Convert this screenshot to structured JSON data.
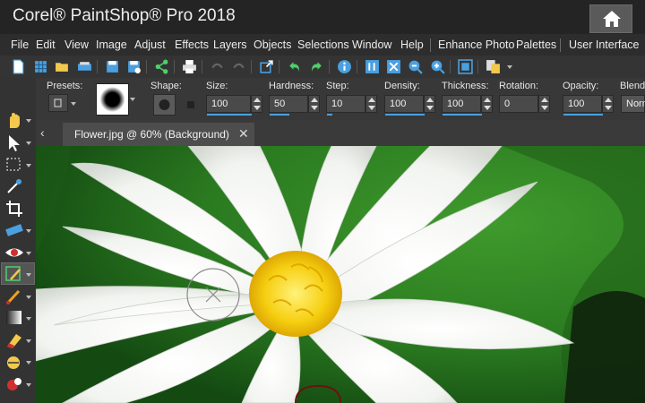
{
  "app": {
    "title": "Corel® PaintShop® Pro 2018"
  },
  "menu": [
    "File",
    "Edit",
    "View",
    "Image",
    "Adjust",
    "Effects",
    "Layers",
    "Objects",
    "Selections",
    "Window",
    "Help",
    "Enhance Photo",
    "Palettes",
    "User Interface"
  ],
  "options": {
    "presets_label": "Presets:",
    "shape_label": "Shape:",
    "size": {
      "label": "Size:",
      "value": "100"
    },
    "hardness": {
      "label": "Hardness:",
      "value": "50"
    },
    "step": {
      "label": "Step:",
      "value": "10"
    },
    "density": {
      "label": "Density:",
      "value": "100"
    },
    "thickness": {
      "label": "Thickness:",
      "value": "100"
    },
    "rotation": {
      "label": "Rotation:",
      "value": "0"
    },
    "opacity": {
      "label": "Opacity:",
      "value": "100"
    },
    "blend": {
      "label": "Blend",
      "value": "Norm"
    }
  },
  "document_tab": {
    "label": "Flower.jpg @  60% (Background)"
  },
  "icons": {
    "toolbar": [
      "new-file-icon",
      "grid-icon",
      "open-folder-icon",
      "scan-icon",
      "save-icon",
      "save-as-icon",
      "share-icon",
      "print-icon",
      "undo-disabled-icon",
      "redo-disabled-icon",
      "resize-icon",
      "undo-icon",
      "redo-icon",
      "info-icon",
      "zoom-actual-icon",
      "fit-window-icon",
      "zoom-out-icon",
      "zoom-in-icon",
      "fit-image-icon",
      "copy-icon"
    ],
    "tools": [
      "pan-icon",
      "pick-icon",
      "selection-icon",
      "dropper-icon",
      "crop-icon",
      "straighten-icon",
      "red-eye-icon",
      "clone-brush-icon",
      "paint-brush-icon",
      "gradient-icon",
      "eraser-icon",
      "scratch-remover-icon",
      "color-replacer-icon"
    ]
  },
  "colors": {
    "accent": "#4aa0e0",
    "menu_bg": "#2d2d2d",
    "title_bg": "#242424",
    "leaf_green": "#2e7d22"
  }
}
